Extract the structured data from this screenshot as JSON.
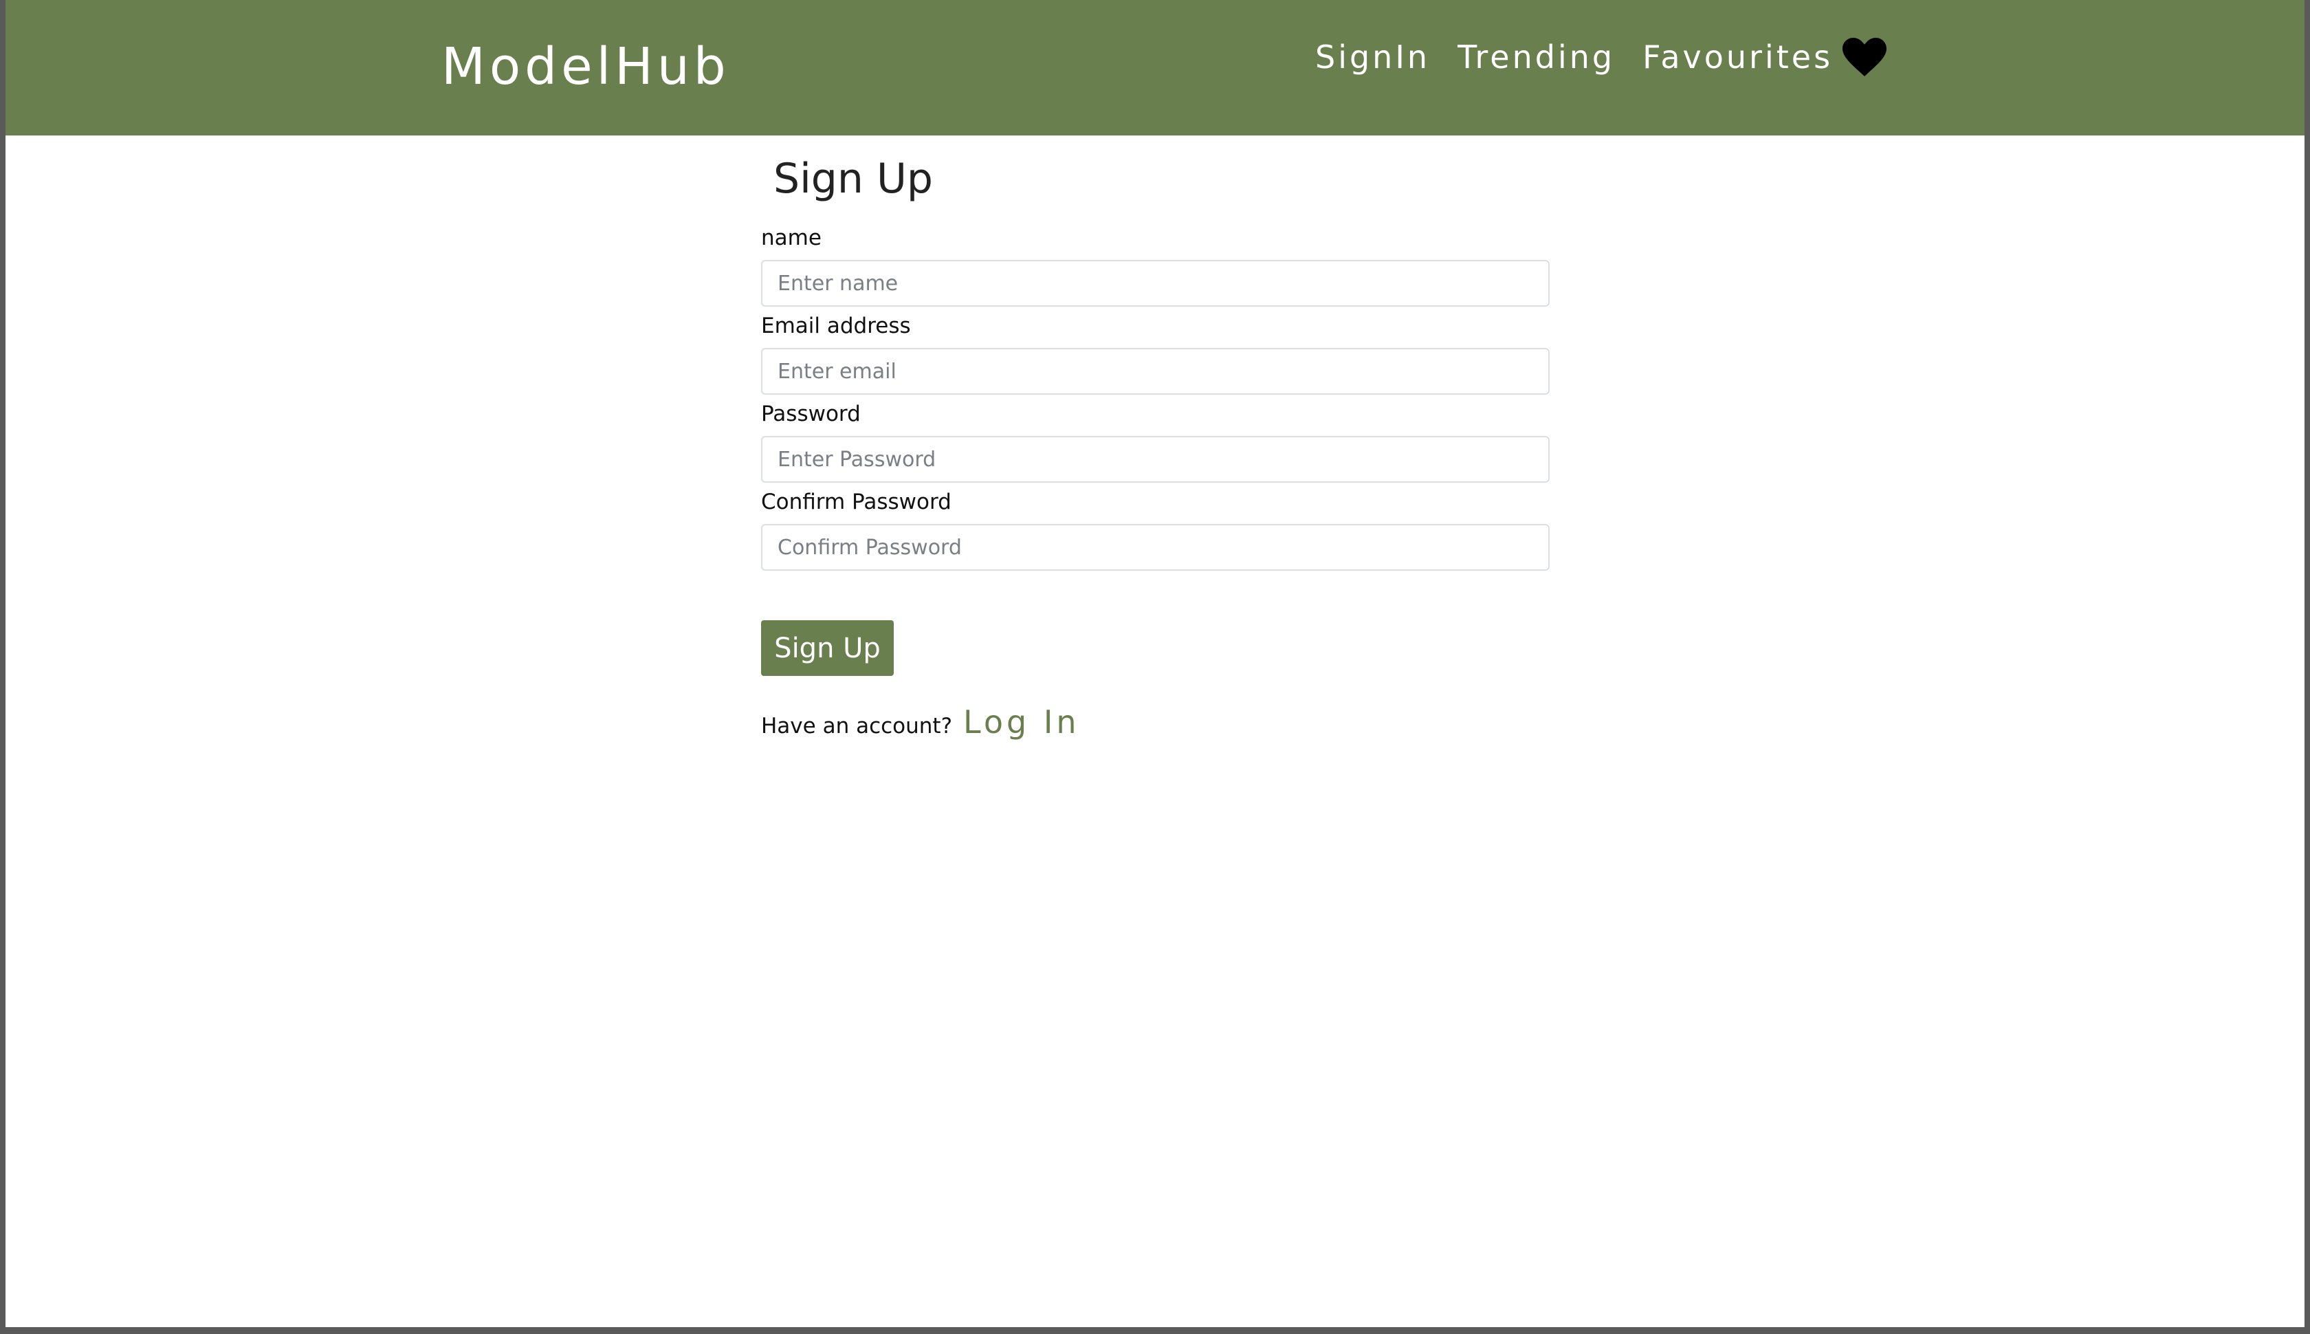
{
  "header": {
    "brand": "ModelHub",
    "nav": [
      "SignIn",
      "Trending",
      "Favourites"
    ],
    "heart_icon": "heart-icon",
    "background_color": "#6a7f4e"
  },
  "form": {
    "title": "Sign Up",
    "fields": [
      {
        "label": "name",
        "placeholder": "Enter name"
      },
      {
        "label": "Email address",
        "placeholder": "Enter email"
      },
      {
        "label": "Password",
        "placeholder": "Enter Password"
      },
      {
        "label": "Confirm Password",
        "placeholder": "Confirm Password"
      }
    ],
    "submit_label": "Sign Up",
    "footer_text": "Have an account?",
    "login_link": "Log In",
    "accent_color": "#6a7f4e"
  }
}
